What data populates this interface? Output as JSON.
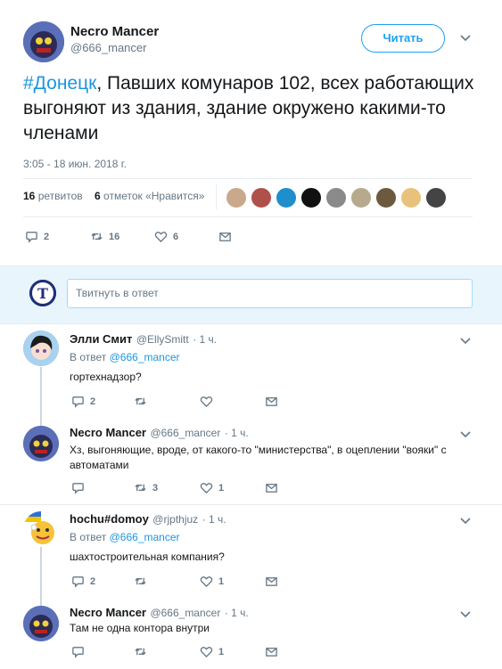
{
  "main_tweet": {
    "author_name": "Necro Mancer",
    "author_handle": "@666_mancer",
    "follow_label": "Читать",
    "hashtag": "#Донецк",
    "text_rest": ", Павших комунаров 102, всех работающих выгоняют из здания, здание окружено какими-то членами",
    "timestamp": "3:05 - 18 июн. 2018 г.",
    "retweets_count": "16",
    "retweets_label": "ретвитов",
    "likes_count": "6",
    "likes_label": "отметок «Нравится»",
    "actions": {
      "reply": "2",
      "retweet": "16",
      "like": "6"
    }
  },
  "reply_box": {
    "placeholder": "Твитнуть в ответ"
  },
  "replies": [
    {
      "name": "Элли Смит",
      "handle": "@EllySmitt",
      "time": "· 1 ч.",
      "reply_to_prefix": "В ответ",
      "reply_to": "@666_mancer",
      "text": "гортехнадзор?",
      "reply": "2",
      "retweet": "",
      "like": ""
    },
    {
      "name": "Necro Mancer",
      "handle": "@666_mancer",
      "time": "· 1 ч.",
      "text": "Хз, выгоняющие, вроде, от какого-то \"министерства\", в оцеплении \"вояки\" с автоматами",
      "reply": "",
      "retweet": "3",
      "like": "1"
    },
    {
      "name": "hochu#domoy",
      "handle": "@rjpthjuz",
      "time": "· 1 ч.",
      "reply_to_prefix": "В ответ",
      "reply_to": "@666_mancer",
      "text": "шахтостроительная компания?",
      "reply": "2",
      "retweet": "",
      "like": "1"
    },
    {
      "name": "Necro Mancer",
      "handle": "@666_mancer",
      "time": "· 1 ч.",
      "text": "Там не одна контора внутри",
      "reply": "",
      "retweet": "",
      "like": "1"
    }
  ],
  "colors": {
    "accent": "#1da1f2",
    "link": "#1b95e0",
    "muted": "#657786"
  }
}
